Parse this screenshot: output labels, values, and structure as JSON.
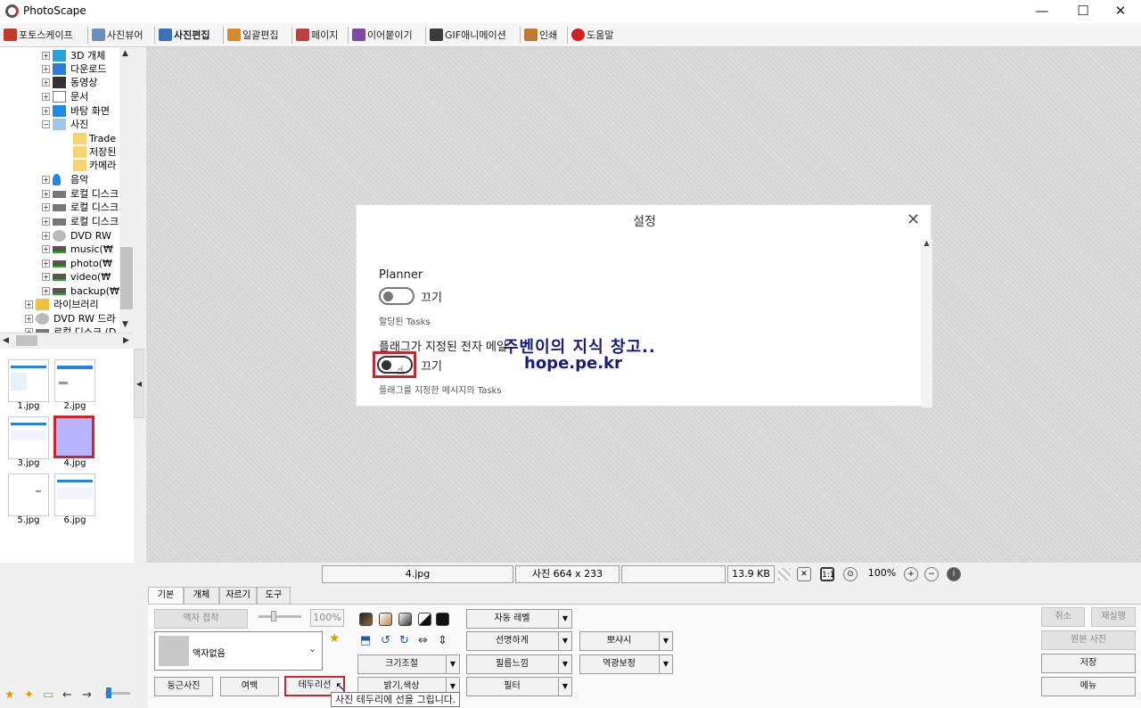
{
  "window": {
    "title": "PhotoScape",
    "minimize": "—",
    "maximize": "☐",
    "close": "✕"
  },
  "tabs": [
    {
      "label": "포토스케이프",
      "color": "#c0392b"
    },
    {
      "label": "사진뷰어",
      "color": "#6a8fb8"
    },
    {
      "label": "사진편집",
      "color": "#3b6fb6"
    },
    {
      "label": "일괄편집",
      "color": "#d68a2a"
    },
    {
      "label": "페이지",
      "color": "#b84040"
    },
    {
      "label": "이어붙이기",
      "color": "#7a4ba0"
    },
    {
      "label": "GIF애니메이션",
      "color": "#3a3a3a"
    },
    {
      "label": "인쇄",
      "color": "#c07a30"
    },
    {
      "label": "도움말",
      "color": "#d02020"
    }
  ],
  "tree": [
    {
      "label": "3D 개체",
      "icon": "cube-icon"
    },
    {
      "label": "다운로드",
      "icon": "download-icon"
    },
    {
      "label": "동영상",
      "icon": "film-icon"
    },
    {
      "label": "문서",
      "icon": "document-icon"
    },
    {
      "label": "바탕 화면",
      "icon": "desktop-icon"
    },
    {
      "label": "사진",
      "icon": "picture-folder-icon"
    },
    {
      "label": "Trade",
      "icon": "folder-icon"
    },
    {
      "label": "저장된",
      "icon": "folder-icon"
    },
    {
      "label": "카메라",
      "icon": "folder-icon"
    },
    {
      "label": "음악",
      "icon": "music-icon"
    },
    {
      "label": "로컬 디스크",
      "icon": "drive-icon"
    },
    {
      "label": "로컬 디스크",
      "icon": "drive-icon"
    },
    {
      "label": "로컬 디스크",
      "icon": "drive-icon"
    },
    {
      "label": "DVD RW",
      "icon": "disc-icon"
    },
    {
      "label": "music(₩",
      "icon": "network-drive-icon"
    },
    {
      "label": "photo(₩",
      "icon": "network-drive-icon"
    },
    {
      "label": "video(₩",
      "icon": "network-drive-icon"
    },
    {
      "label": "backup(₩",
      "icon": "network-drive-icon"
    },
    {
      "label": "라이브러리",
      "icon": "library-icon"
    },
    {
      "label": "DVD RW 드라",
      "icon": "disc-icon"
    },
    {
      "label": "로컬 디스크 (D",
      "icon": "drive-icon"
    }
  ],
  "thumbnails": [
    {
      "label": "1.jpg"
    },
    {
      "label": "2.jpg"
    },
    {
      "label": "3.jpg"
    },
    {
      "label": "4.jpg"
    },
    {
      "label": "5.jpg"
    },
    {
      "label": "6.jpg"
    }
  ],
  "dialog": {
    "title": "설정",
    "close": "✕",
    "scroll_up": "▲",
    "section1": {
      "heading": "Planner",
      "toggle_label": "끄기",
      "sub": "할당된 Tasks"
    },
    "section2": {
      "heading": "플래그가 지정된 전자 메일",
      "toggle_label": "끄기",
      "sub": "플래그를 지정한 메시지의 Tasks"
    },
    "watermark_line1": "주벤이의 지식 창고..",
    "watermark_line2": "hope.pe.kr"
  },
  "status": {
    "filename": "4.jpg",
    "dimensions": "사진 664 x 233",
    "extra": "",
    "filesize": "13.9 KB",
    "zoom": "100%"
  },
  "edit_tabs": [
    "기본",
    "개체",
    "자르기",
    "도구"
  ],
  "panel": {
    "frame_fit": "액자 접착",
    "opacity": "100%",
    "frame_none": "액자없음",
    "round_photo": "둥근사진",
    "margin": "여백",
    "border_line": "테두리선",
    "auto_level": "자동 레벨",
    "sharpen": "선명하게",
    "film_effect": "필름느낌",
    "filter": "필터",
    "resize": "크기조절",
    "brightness_color": "밝기,색상",
    "bloom": "뽀샤시",
    "backlight": "역광보정",
    "undo": "취소",
    "redo": "재실행",
    "original": "원본 사진",
    "save": "저장",
    "menu": "메뉴",
    "dropdown_arrow": "▼"
  },
  "tooltip": "사진 테두리에 선을 그립니다.",
  "colors": {
    "highlight": "#c8262e",
    "watermark": "#1a1a7a",
    "selected_thumb": "#b8b4ff"
  }
}
